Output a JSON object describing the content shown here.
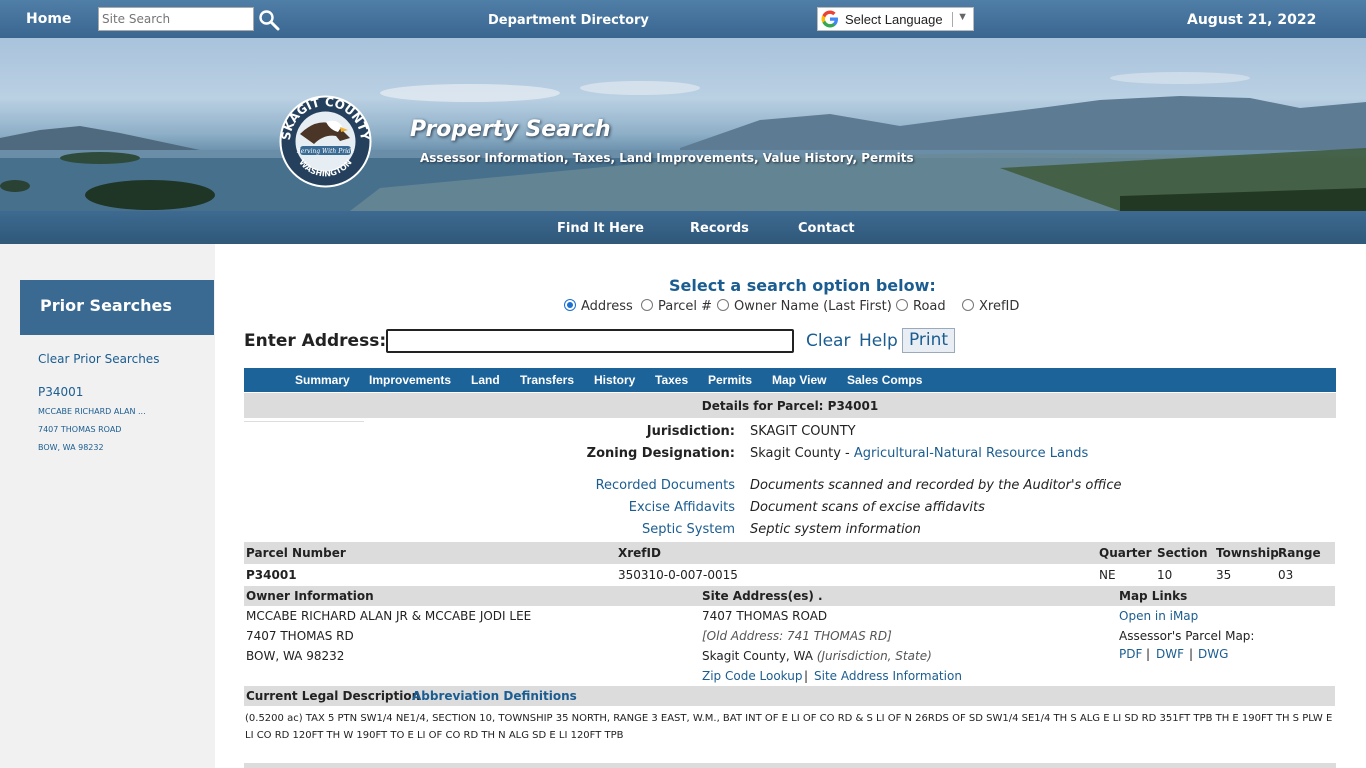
{
  "topbar": {
    "home": "Home",
    "search_placeholder": "Site Search",
    "department_directory": "Department Directory",
    "language": "Select Language",
    "date": "August 21, 2022"
  },
  "banner": {
    "logo_text": "SKAGIT COUNTY",
    "logo_motto": "Serving With Pride",
    "logo_state": "WASHINGTON",
    "title": "Property Search",
    "subtitle": "Assessor Information, Taxes, Land Improvements, Value History, Permits"
  },
  "nav": [
    "Find It Here",
    "Records",
    "Contact"
  ],
  "sidebar": {
    "heading": "Prior Searches",
    "clear": "Clear Prior Searches",
    "recent_parcel": "P34001",
    "recent_owner": "MCCABE RICHARD ALAN ...",
    "recent_address1": "7407 THOMAS ROAD",
    "recent_address2": "BOW, WA 98232"
  },
  "search": {
    "prompt": "Select a search option below:",
    "options": [
      "Address",
      "Parcel #",
      "Owner Name (Last First)",
      "Road",
      "XrefID"
    ],
    "selected": "Address",
    "enter_label": "Enter Address:",
    "value": "",
    "clear": "Clear",
    "help": "Help",
    "print": "Print"
  },
  "tabs": [
    "Summary",
    "Improvements",
    "Land",
    "Transfers",
    "History",
    "Taxes",
    "Permits",
    "Map View",
    "Sales Comps"
  ],
  "details_title": "Details for Parcel: P34001",
  "jurisdiction": {
    "label": "Jurisdiction:",
    "value": "SKAGIT COUNTY"
  },
  "zoning": {
    "label": "Zoning Designation:",
    "value_prefix": "Skagit County - ",
    "value_link": "Agricultural-Natural Resource Lands"
  },
  "records": [
    {
      "link": "Recorded Documents",
      "desc": "Documents scanned and recorded by the Auditor's office"
    },
    {
      "link": "Excise Affidavits",
      "desc": "Document scans of excise affidavits"
    },
    {
      "link": "Septic System",
      "desc": "Septic system information"
    }
  ],
  "parcel": {
    "headers": {
      "parcel_number": "Parcel Number",
      "xrefid": "XrefID",
      "quarter": "Quarter",
      "section": "Section",
      "township": "Township",
      "range": "Range"
    },
    "parcel_number": "P34001",
    "xrefid": "350310-0-007-0015",
    "quarter": "NE",
    "section": "10",
    "township": "35",
    "range": "03"
  },
  "owner": {
    "header": "Owner Information",
    "name": "MCCABE RICHARD ALAN JR & MCCABE JODI LEE",
    "street": "7407 THOMAS RD",
    "city": "BOW, WA  98232"
  },
  "site": {
    "header": "Site Address(es) .",
    "address": "7407  THOMAS ROAD",
    "old_address": "[Old Address: 741  THOMAS RD]",
    "jurisdiction": "Skagit County, WA",
    "jurisdiction_note": "(Jurisdiction, State)",
    "zip_lookup": "Zip Code Lookup",
    "sep": "|",
    "site_info": "Site Address Information"
  },
  "maplinks": {
    "header": "Map Links",
    "imap": "Open in iMap",
    "parcel_map_label": "Assessor's Parcel Map:",
    "pdf": "PDF",
    "dwf": "DWF",
    "dwg": "DWG",
    "sep": "|"
  },
  "legal": {
    "header": "Current Legal Description",
    "abbrev": "Abbreviation Definitions",
    "text": "(0.5200 ac) TAX 5 PTN SW1/4 NE1/4, SECTION 10, TOWNSHIP 35 NORTH, RANGE 3 EAST, W.M., BAT INT OF E LI OF CO RD & S LI OF N 26RDS OF SD SW1/4 SE1/4 TH S ALG E LI SD RD 351FT TPB TH E 190FT TH S PLW E LI CO RD 120FT TH W 190FT TO E LI OF CO RD TH N ALG SD E LI 120FT TPB"
  },
  "colors": {
    "brand_blue": "#3a6a92",
    "link": "#1b5d91",
    "tab_bar": "#1c639a"
  }
}
